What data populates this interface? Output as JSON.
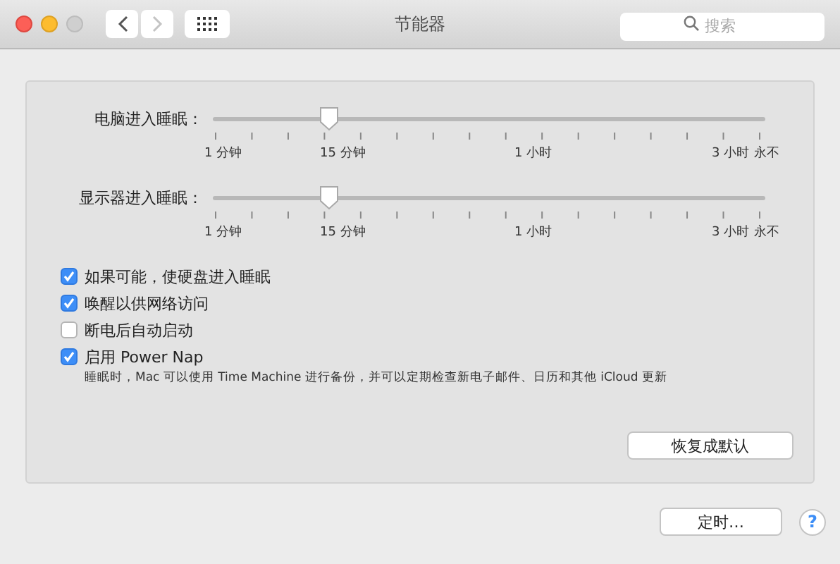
{
  "window": {
    "title": "节能器",
    "search": {
      "placeholder": "搜索"
    }
  },
  "sliders": [
    {
      "label": "电脑进入睡眠：",
      "level": 0.21,
      "ticks": [
        "1 分钟",
        "15 分钟",
        "1 小时",
        "3 小时",
        "永不"
      ]
    },
    {
      "label": "显示器进入睡眠：",
      "level": 0.21,
      "ticks": [
        "1 分钟",
        "15 分钟",
        "1 小时",
        "3 小时",
        "永不"
      ]
    }
  ],
  "options": [
    {
      "label": "如果可能，使硬盘进入睡眠",
      "checked": true
    },
    {
      "label": "唤醒以供网络访问",
      "checked": true
    },
    {
      "label": "断电后自动启动",
      "checked": false
    },
    {
      "label": "启用 Power Nap",
      "checked": true,
      "description": "睡眠时，Mac 可以使用 Time Machine 进行备份，并可以定期检查新电子邮件、日历和其他 iCloud 更新"
    }
  ],
  "restore_button": "恢复成默认",
  "schedule_button": "定时…",
  "help_button": "?"
}
